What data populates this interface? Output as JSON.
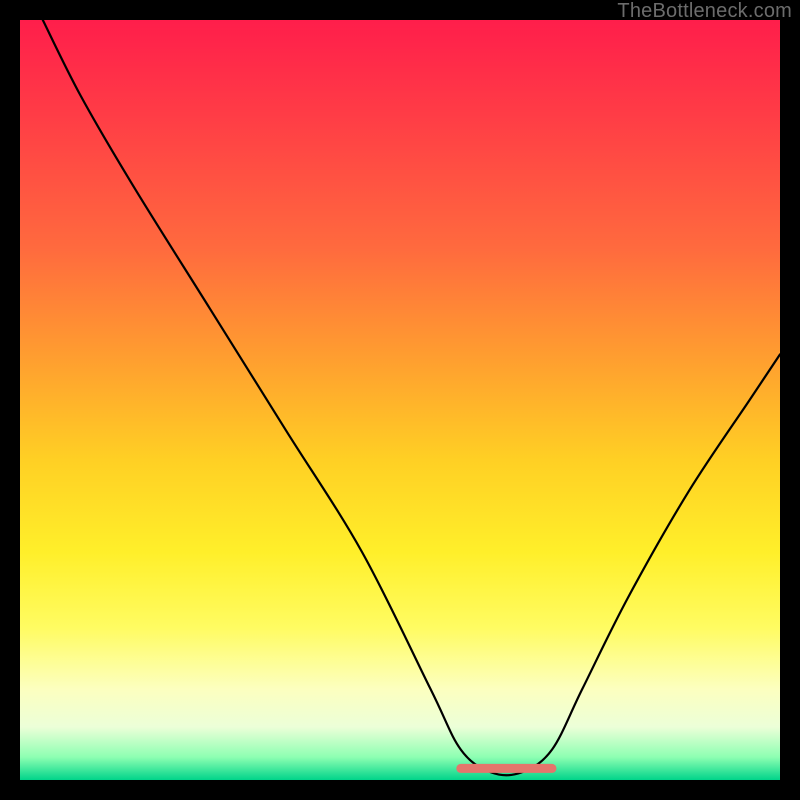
{
  "watermark": "TheBottleneck.com",
  "chart_data": {
    "type": "line",
    "title": "",
    "xlabel": "",
    "ylabel": "",
    "xlim": [
      0,
      100
    ],
    "ylim": [
      0,
      100
    ],
    "series": [
      {
        "name": "bottleneck-curve",
        "x": [
          3,
          8,
          15,
          25,
          35,
          45,
          54,
          58,
          62,
          66,
          70,
          74,
          80,
          88,
          96,
          100
        ],
        "values": [
          100,
          90,
          78,
          62,
          46,
          30,
          12,
          4,
          1,
          1,
          4,
          12,
          24,
          38,
          50,
          56
        ]
      }
    ],
    "markers": [
      {
        "name": "flat-segment",
        "x_start": 58,
        "x_end": 70,
        "y": 1
      }
    ],
    "background_gradient": {
      "direction": "vertical",
      "stops": [
        {
          "pos": 0,
          "color": "#ff1e4b"
        },
        {
          "pos": 12,
          "color": "#ff3b46"
        },
        {
          "pos": 30,
          "color": "#ff6a3e"
        },
        {
          "pos": 45,
          "color": "#ffa02f"
        },
        {
          "pos": 58,
          "color": "#ffd024"
        },
        {
          "pos": 70,
          "color": "#ffef2a"
        },
        {
          "pos": 80,
          "color": "#fffc62"
        },
        {
          "pos": 88,
          "color": "#fcffbf"
        },
        {
          "pos": 93,
          "color": "#ecffd8"
        },
        {
          "pos": 97,
          "color": "#8dffb2"
        },
        {
          "pos": 100,
          "color": "#00d48a"
        }
      ]
    },
    "colors": {
      "curve": "#000000",
      "marker": "#e4756c",
      "frame": "#000000"
    }
  }
}
